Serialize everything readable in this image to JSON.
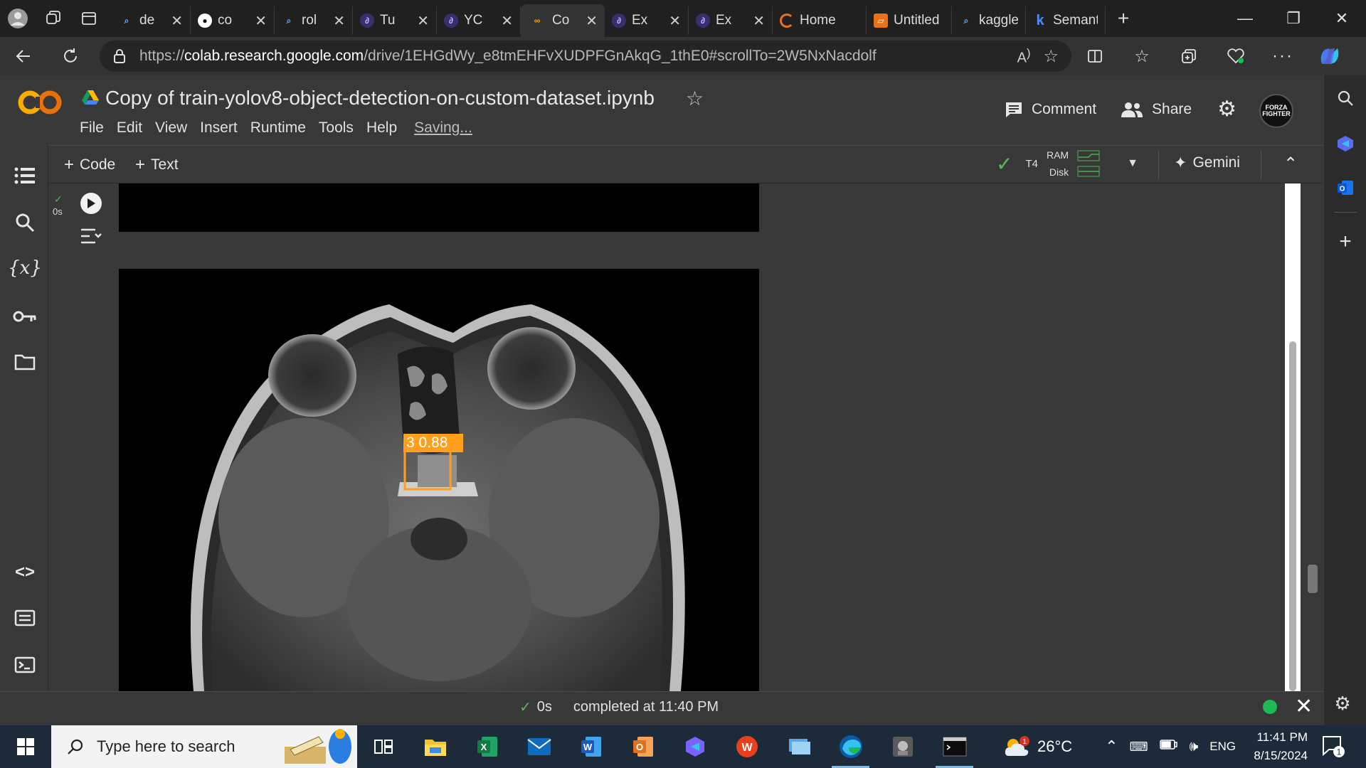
{
  "browser": {
    "tabs": [
      {
        "label": "de",
        "icon": "search-icon"
      },
      {
        "label": "co",
        "icon": "github-icon"
      },
      {
        "label": "rol",
        "icon": "search-icon"
      },
      {
        "label": "Tu",
        "icon": "perplexity-icon"
      },
      {
        "label": "YC",
        "icon": "perplexity-icon"
      },
      {
        "label": "Co",
        "icon": "colab-icon",
        "active": true
      },
      {
        "label": "Ex",
        "icon": "perplexity-icon"
      },
      {
        "label": "Ex",
        "icon": "perplexity-icon"
      },
      {
        "label": "Home",
        "icon": "loading-icon"
      },
      {
        "label": "Untitled",
        "icon": "notebook-icon"
      },
      {
        "label": "kaggle",
        "icon": "search-icon"
      },
      {
        "label": "Semant",
        "icon": "k-icon"
      }
    ],
    "url_prefix": "https://",
    "url_host": "colab.research.google.com",
    "url_path": "/drive/1EHGdWy_e8tmEHFvXUDPFGnAkqG_1thE0#scrollTo=2W5NxNacdolf"
  },
  "colab": {
    "logo": "CO",
    "title": "Copy of train-yolov8-object-detection-on-custom-dataset.ipynb",
    "menu": [
      "File",
      "Edit",
      "View",
      "Insert",
      "Runtime",
      "Tools",
      "Help"
    ],
    "saving": "Saving...",
    "comment_label": "Comment",
    "share_label": "Share",
    "avatar_text": "FORZA FIGHTER",
    "add_code": "Code",
    "add_text": "Text",
    "runtime_gpu": "T4",
    "ram_label": "RAM",
    "disk_label": "Disk",
    "gemini_label": "Gemini",
    "cell_exec_time": "0s",
    "detection_label": "3  0.88",
    "status_time": "0s",
    "status_completed": "completed at 11:40 PM",
    "colors": {
      "accent_orange": "#f9ab00",
      "ok_green": "#5cb85c",
      "bbox": "#ff9f1c"
    }
  },
  "taskbar": {
    "search_placeholder": "Type here to search",
    "weather": "26°C",
    "language": "ENG",
    "time": "11:41 PM",
    "date": "8/15/2024",
    "notif_count": "1",
    "weather_badge": "1"
  }
}
